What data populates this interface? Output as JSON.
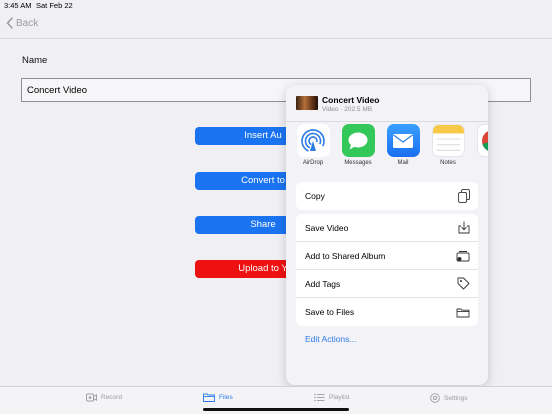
{
  "status_bar": {
    "time": "3:45 AM",
    "date": "Sat Feb 22"
  },
  "nav": {
    "back_label": "Back"
  },
  "form": {
    "name_label": "Name",
    "name_value": "Concert Video"
  },
  "buttons": [
    {
      "label": "Insert Au",
      "color": "#1a73f0"
    },
    {
      "label": "Convert to",
      "color": "#1a73f0"
    },
    {
      "label": "Share",
      "color": "#1a73f0"
    },
    {
      "label": "Upload to Y",
      "color": "#ee1111"
    }
  ],
  "share_sheet": {
    "title": "Concert Video",
    "subtitle": "Video · 202.5 MB",
    "apps": [
      {
        "label": "AirDrop",
        "icon": "airdrop-icon"
      },
      {
        "label": "Messages",
        "icon": "messages-icon"
      },
      {
        "label": "Mail",
        "icon": "mail-icon"
      },
      {
        "label": "Notes",
        "icon": "notes-icon"
      },
      {
        "label": "Ch",
        "icon": "chrome-icon"
      }
    ],
    "actions_top": [
      {
        "label": "Copy",
        "icon": "copy-icon"
      }
    ],
    "actions_main": [
      {
        "label": "Save Video",
        "icon": "save-download-icon"
      },
      {
        "label": "Add to Shared Album",
        "icon": "shared-album-icon"
      },
      {
        "label": "Add Tags",
        "icon": "tag-icon"
      },
      {
        "label": "Save to Files",
        "icon": "folder-icon"
      }
    ],
    "edit_actions": "Edit Actions..."
  },
  "tab_bar": {
    "items": [
      {
        "label": "Record",
        "icon": "record-icon",
        "active": false
      },
      {
        "label": "Files",
        "icon": "files-icon",
        "active": true
      },
      {
        "label": "Playlist",
        "icon": "playlist-icon",
        "active": false
      },
      {
        "label": "Settings",
        "icon": "settings-icon",
        "active": false
      }
    ]
  },
  "colors": {
    "accent": "#2a7be6",
    "primary_button": "#1a73f0",
    "danger_button": "#ee1111"
  }
}
